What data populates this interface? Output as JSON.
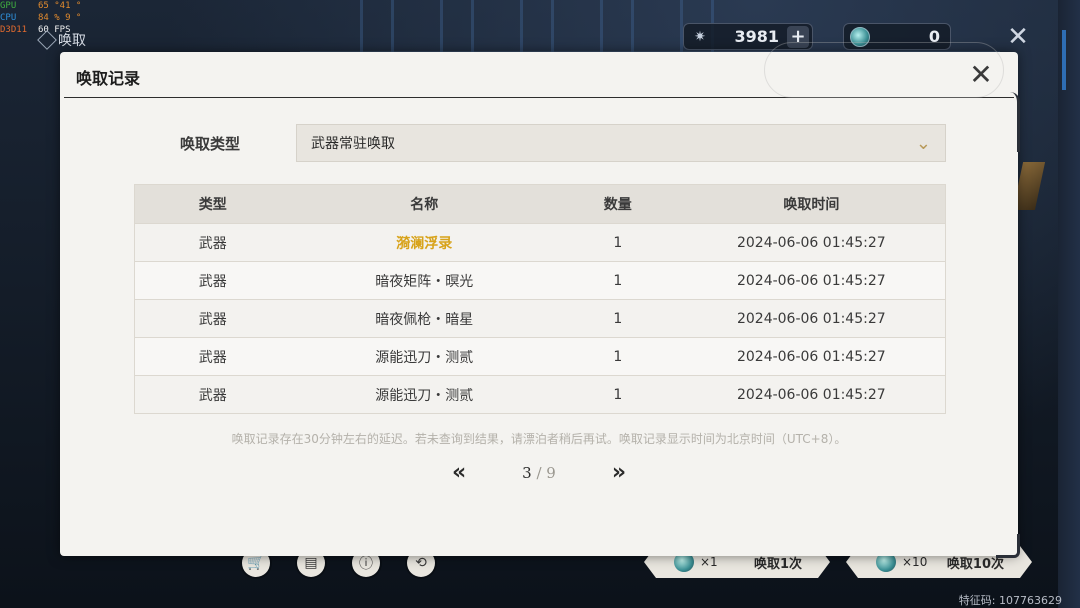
{
  "perf": {
    "gpu": {
      "label": "GPU",
      "value": "65 °41 °"
    },
    "cpu": {
      "label": "CPU",
      "value": "84 % 9 °"
    },
    "d3d": {
      "label": "D3D11",
      "value": "60 FPS"
    }
  },
  "top_title": "唤取",
  "currency": {
    "astrite": "3981",
    "astrite_plus": "+",
    "lustrous": "0"
  },
  "modal": {
    "title": "唤取记录",
    "filter_label": "唤取类型",
    "filter_value": "武器常驻唤取",
    "columns": [
      "类型",
      "名称",
      "数量",
      "唤取时间"
    ],
    "rows": [
      {
        "type": "武器",
        "name": "漪澜浮录",
        "qty": "1",
        "time": "2024-06-06 01:45:27",
        "highlight": true
      },
      {
        "type": "武器",
        "name": "暗夜矩阵・暝光",
        "qty": "1",
        "time": "2024-06-06 01:45:27"
      },
      {
        "type": "武器",
        "name": "暗夜佩枪・暗星",
        "qty": "1",
        "time": "2024-06-06 01:45:27"
      },
      {
        "type": "武器",
        "name": "源能迅刀・测贰",
        "qty": "1",
        "time": "2024-06-06 01:45:27"
      },
      {
        "type": "武器",
        "name": "源能迅刀・测贰",
        "qty": "1",
        "time": "2024-06-06 01:45:27"
      }
    ],
    "notice": "唤取记录存在30分钟左右的延迟。若未查询到结果，请漂泊者稍后再试。唤取记录显示时间为北京时间（UTC+8）。",
    "pager": {
      "current": "3",
      "separator": " / ",
      "total": "9"
    }
  },
  "bottom": {
    "pull_1": {
      "count": "×1",
      "label": "唤取1次"
    },
    "pull_10": {
      "count": "×10",
      "label": "唤取10次"
    },
    "feature_code": "特征码: 107763629"
  },
  "colors": {
    "highlight": "#d8a31a",
    "modal_bg": "#f4f3f0"
  }
}
